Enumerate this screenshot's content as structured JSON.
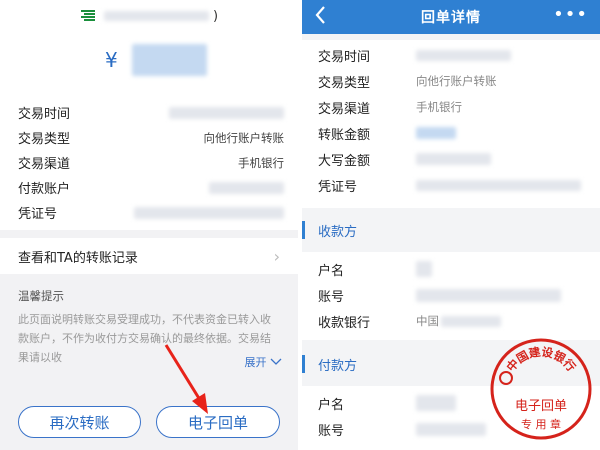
{
  "left": {
    "currency_symbol": "¥",
    "paren_close": ")",
    "details": [
      {
        "label": "交易时间",
        "value": ""
      },
      {
        "label": "交易类型",
        "value": "向他行账户转账"
      },
      {
        "label": "交易渠道",
        "value": "手机银行"
      },
      {
        "label": "付款账户",
        "value": ""
      },
      {
        "label": "凭证号",
        "value": ""
      }
    ],
    "record_link": "查看和TA的转账记录",
    "notice_title": "温馨提示",
    "notice_text": "此页面说明转账交易受理成功，不代表资金已转入收款账户，不作为收付方交易确认的最终依据。交易结果请以收",
    "expand_label": "展开",
    "button_again": "再次转账",
    "button_receipt": "电子回单"
  },
  "right": {
    "title": "回单详情",
    "rows": [
      {
        "label": "交易时间",
        "value": ""
      },
      {
        "label": "交易类型",
        "value": "向他行账户转账"
      },
      {
        "label": "交易渠道",
        "value": "手机银行"
      },
      {
        "label": "转账金额",
        "value": ""
      },
      {
        "label": "大写金额",
        "value": ""
      },
      {
        "label": "凭证号",
        "value": ""
      }
    ],
    "payee_section": "收款方",
    "payee_rows": [
      {
        "label": "户名",
        "value": ""
      },
      {
        "label": "账号",
        "value": ""
      },
      {
        "label": "收款银行",
        "value": "中国"
      }
    ],
    "payer_section": "付款方",
    "payer_rows": [
      {
        "label": "户名",
        "value": ""
      },
      {
        "label": "账号",
        "value": ""
      }
    ],
    "stamp": {
      "bank_name": "中国建设银行",
      "line1": "电子回单",
      "line2": "专 用 章"
    }
  },
  "colors": {
    "accent": "#2f80d2",
    "arrow": "#e8231a",
    "stamp": "#d5231b"
  }
}
